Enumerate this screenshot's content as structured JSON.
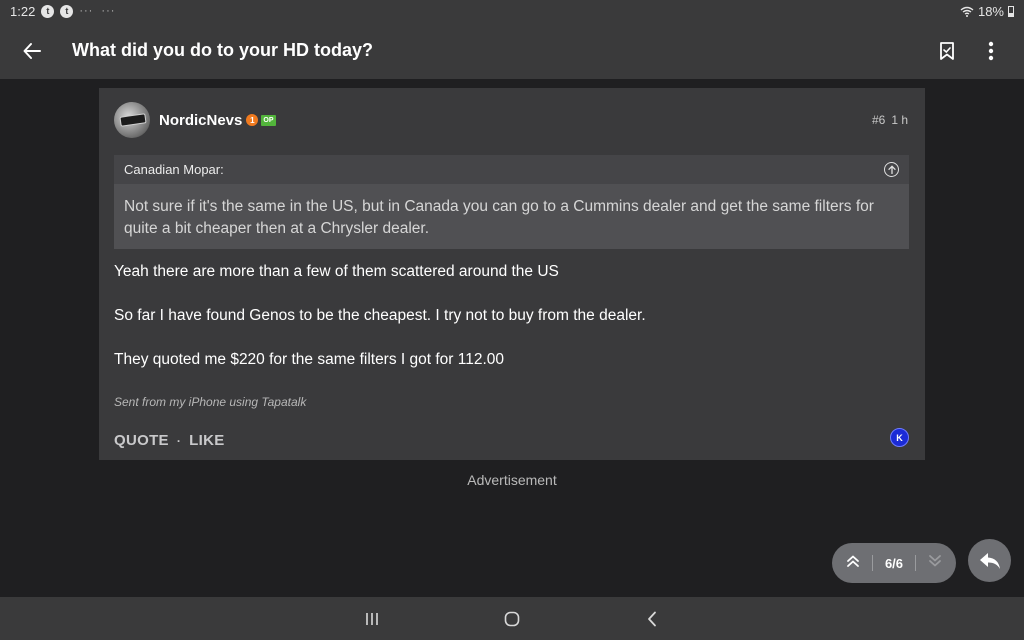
{
  "status_bar": {
    "time": "1:22",
    "notif_icons": [
      "tapatalk-icon",
      "tapatalk-icon"
    ],
    "more_dots": "···",
    "battery": "18%"
  },
  "app_bar": {
    "title": "What did you do to your HD today?",
    "back_icon": "arrow-left-icon",
    "bookmark_icon": "bookmark-icon",
    "menu_icon": "more-vert-icon"
  },
  "post": {
    "username": "NordicNevs",
    "badge_round": "1",
    "badge_op": "OP",
    "post_number": "#6",
    "time_ago": "1 h",
    "quote": {
      "author": "Canadian Mopar:",
      "text": "Not sure if it's the same in the US, but in Canada you can go to a Cummins dealer and get the same filters for quite a bit cheaper then at a Chrysler dealer."
    },
    "paragraphs": [
      "Yeah there are more than a few of them scattered around the US",
      "So far I have found Genos to be the cheapest. I try not to buy from the dealer.",
      "They quoted me $220 for the same filters I got for 112.00"
    ],
    "signature": "Sent from my iPhone using Tapatalk",
    "actions": {
      "quote": "QUOTE",
      "separator": "·",
      "like": "LIKE"
    },
    "tapatalk_badge": "K"
  },
  "advertisement_label": "Advertisement",
  "pager": {
    "page_label": "6/6"
  },
  "colors": {
    "background": "#1f1f21",
    "bars": "#3a3a3b",
    "card": "#3a3a3c",
    "quote": "#505053",
    "op_badge": "#52b43b",
    "rank_badge": "#f07a1f",
    "tapatalk_badge": "#1b2bd6"
  }
}
